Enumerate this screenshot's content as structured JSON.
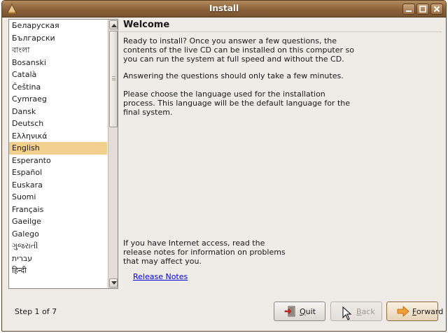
{
  "window": {
    "title": "Install"
  },
  "languages": {
    "items": [
      "Беларуская",
      "Български",
      "বাংলা",
      "Bosanski",
      "Català",
      "Čeština",
      "Cymraeg",
      "Dansk",
      "Deutsch",
      "Ελληνικά",
      "English",
      "Esperanto",
      "Español",
      "Euskara",
      "Suomi",
      "Français",
      "Gaeilge",
      "Galego",
      "ગુજરાતી",
      "עברית",
      "हिन्दी"
    ],
    "selected": "English"
  },
  "content": {
    "title": "Welcome",
    "p1": "Ready to install? Once you answer a few questions, the contents of the live CD can be installed on this computer so you can run the system at full speed and without the CD.",
    "p2": "Answering the questions should only take a few minutes.",
    "p3": "Please choose the language used for the installation process. This language will be the default language for the final system.",
    "p4": "If you have Internet access, read the release notes for information on problems that may affect you.",
    "release_notes": "Release Notes"
  },
  "footer": {
    "step": "Step 1 of 7",
    "quit_label": "Quit",
    "back_label": "Back",
    "forward_label": "Forward"
  },
  "colors": {
    "titlebar": "#8a6139",
    "selection": "#f2ce8f",
    "link": "#0000d8",
    "window_bg": "#efebe7"
  },
  "icons": {
    "app": "install-icon",
    "quit": "quit-icon",
    "back": "back-icon",
    "forward": "forward-arrow-icon"
  }
}
